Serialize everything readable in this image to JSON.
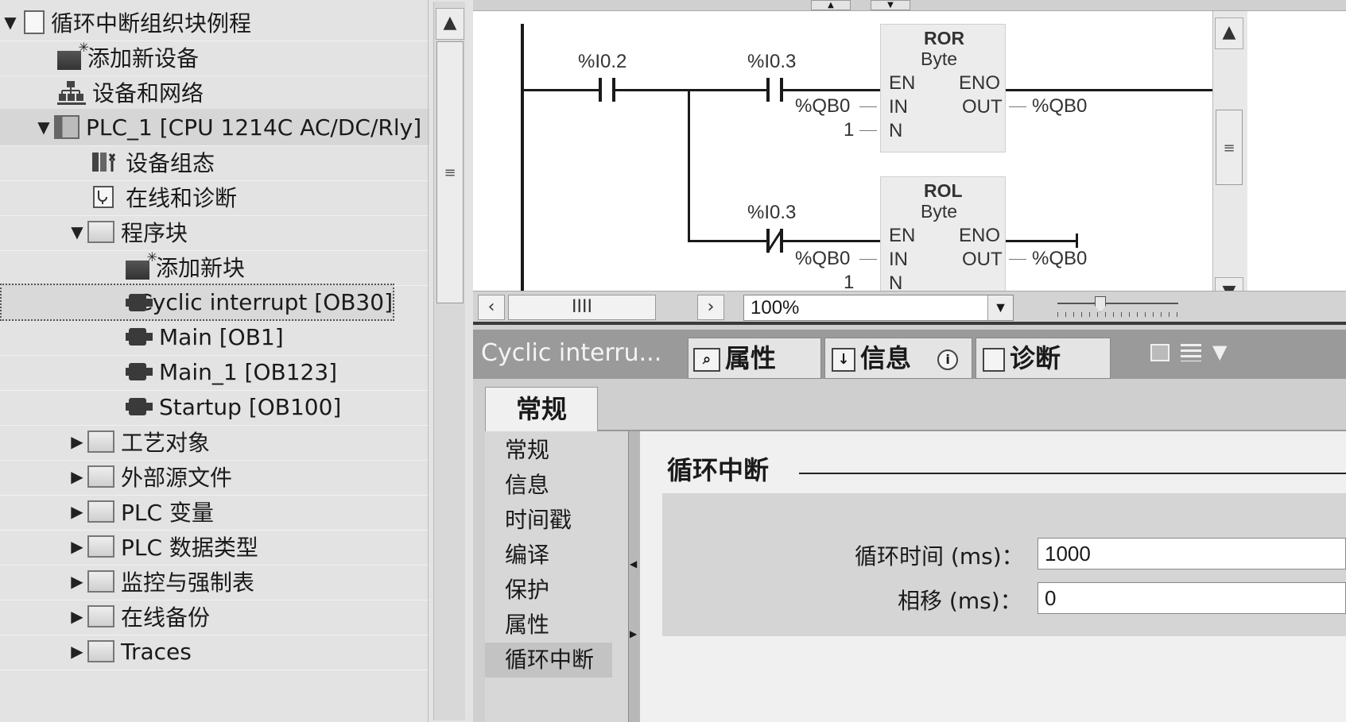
{
  "tree": {
    "project": "循环中断组织块例程",
    "add_device": "添加新设备",
    "devices_networks": "设备和网络",
    "plc": "PLC_1 [CPU 1214C AC/DC/Rly]",
    "device_config": "设备组态",
    "online_diag": "在线和诊断",
    "program_blocks": "程序块",
    "add_block": "添加新块",
    "blocks": [
      "Cyclic interrupt [OB30]",
      "Main [OB1]",
      "Main_1 [OB123]",
      "Startup [OB100]"
    ],
    "folders": [
      "工艺对象",
      "外部源文件",
      "PLC 变量",
      "PLC 数据类型",
      "监控与强制表",
      "在线备份",
      "Traces"
    ]
  },
  "ladder": {
    "contact1": "%I0.2",
    "contact2": "%I0.3",
    "contact3": "%I0.3",
    "ror_title": "ROR",
    "ror_type": "Byte",
    "rol_title": "ROL",
    "rol_type": "Byte",
    "pin_en": "EN",
    "pin_eno": "ENO",
    "pin_in": "IN",
    "pin_out": "OUT",
    "pin_n": "N",
    "in_operand": "%QB0",
    "out_operand": "%QB0",
    "n_value": "1"
  },
  "editor": {
    "zoom": "100%",
    "hscroll_glyph": "IIII"
  },
  "inspector": {
    "title": "Cyclic interru...",
    "tab_properties": "属性",
    "tab_info": "信息",
    "tab_diagnostics": "诊断",
    "section_tab": "常规",
    "nav": [
      "常规",
      "信息",
      "时间戳",
      "编译",
      "保护",
      "属性",
      "循环中断"
    ],
    "heading": "循环中断",
    "cycle_label": "循环时间 (ms)：",
    "cycle_value": "1000",
    "phase_label": "相移 (ms)：",
    "phase_value": "0"
  }
}
